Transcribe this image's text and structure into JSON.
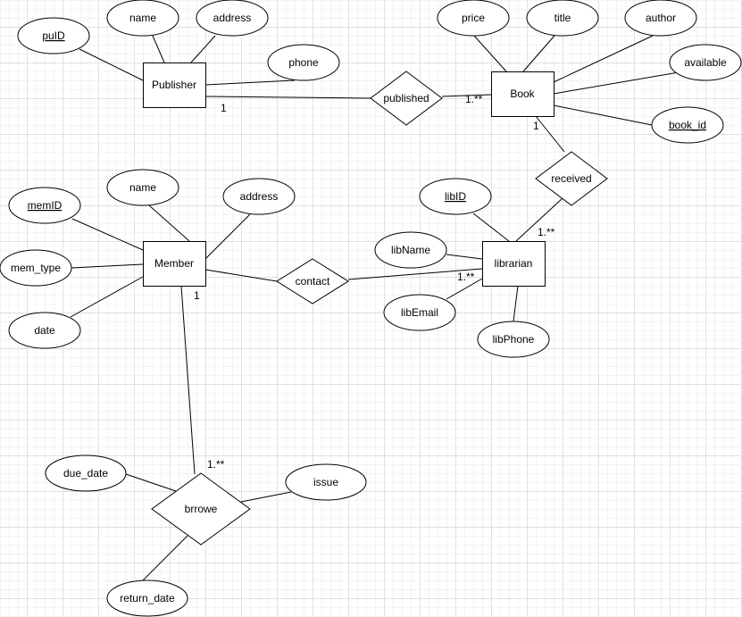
{
  "diagram": {
    "type": "er-diagram",
    "entities": [
      {
        "id": "publisher",
        "label": "Publisher"
      },
      {
        "id": "book",
        "label": "Book"
      },
      {
        "id": "member",
        "label": "Member"
      },
      {
        "id": "librarian",
        "label": "librarian"
      }
    ],
    "relationships": [
      {
        "id": "published",
        "label": "published"
      },
      {
        "id": "received",
        "label": "received"
      },
      {
        "id": "contact",
        "label": "contact"
      },
      {
        "id": "brrowe",
        "label": "brrowe"
      }
    ],
    "attributes": [
      {
        "id": "puID",
        "label": "puID",
        "key": true,
        "owner": "publisher"
      },
      {
        "id": "pub_name",
        "label": "name",
        "key": false,
        "owner": "publisher"
      },
      {
        "id": "pub_address",
        "label": "address",
        "key": false,
        "owner": "publisher"
      },
      {
        "id": "phone",
        "label": "phone",
        "key": false,
        "owner": "publisher"
      },
      {
        "id": "price",
        "label": "price",
        "key": false,
        "owner": "book"
      },
      {
        "id": "title",
        "label": "title",
        "key": false,
        "owner": "book"
      },
      {
        "id": "author",
        "label": "author",
        "key": false,
        "owner": "book"
      },
      {
        "id": "available",
        "label": "available",
        "key": false,
        "owner": "book"
      },
      {
        "id": "book_id",
        "label": "book_id",
        "key": true,
        "owner": "book"
      },
      {
        "id": "memID",
        "label": "memID",
        "key": true,
        "owner": "member"
      },
      {
        "id": "mem_name",
        "label": "name",
        "key": false,
        "owner": "member"
      },
      {
        "id": "mem_address",
        "label": "address",
        "key": false,
        "owner": "member"
      },
      {
        "id": "mem_type",
        "label": "mem_type",
        "key": false,
        "owner": "member"
      },
      {
        "id": "date",
        "label": "date",
        "key": false,
        "owner": "member"
      },
      {
        "id": "libID",
        "label": "libID",
        "key": true,
        "owner": "librarian"
      },
      {
        "id": "libName",
        "label": "libName",
        "key": false,
        "owner": "librarian"
      },
      {
        "id": "libEmail",
        "label": "libEmail",
        "key": false,
        "owner": "librarian"
      },
      {
        "id": "libPhone",
        "label": "libPhone",
        "key": false,
        "owner": "librarian"
      },
      {
        "id": "due_date",
        "label": "due_date",
        "key": false,
        "owner": "brrowe"
      },
      {
        "id": "issue",
        "label": "issue",
        "key": false,
        "owner": "brrowe"
      },
      {
        "id": "return_date",
        "label": "return_date",
        "key": false,
        "owner": "brrowe"
      }
    ],
    "connections": [
      {
        "from": "publisher",
        "to": "published",
        "cardinality": "1"
      },
      {
        "from": "published",
        "to": "book",
        "cardinality": "1.**"
      },
      {
        "from": "book",
        "to": "received",
        "cardinality": "1"
      },
      {
        "from": "received",
        "to": "librarian",
        "cardinality": "1.**"
      },
      {
        "from": "member",
        "to": "contact",
        "cardinality": "1"
      },
      {
        "from": "contact",
        "to": "librarian",
        "cardinality": "1.**"
      },
      {
        "from": "member",
        "to": "brrowe",
        "cardinality": "1.**"
      }
    ],
    "colors": {
      "background": "#ffffff",
      "stroke": "#000000",
      "grid_major": "#e0e0e0",
      "grid_minor": "#f3f3f3"
    }
  }
}
